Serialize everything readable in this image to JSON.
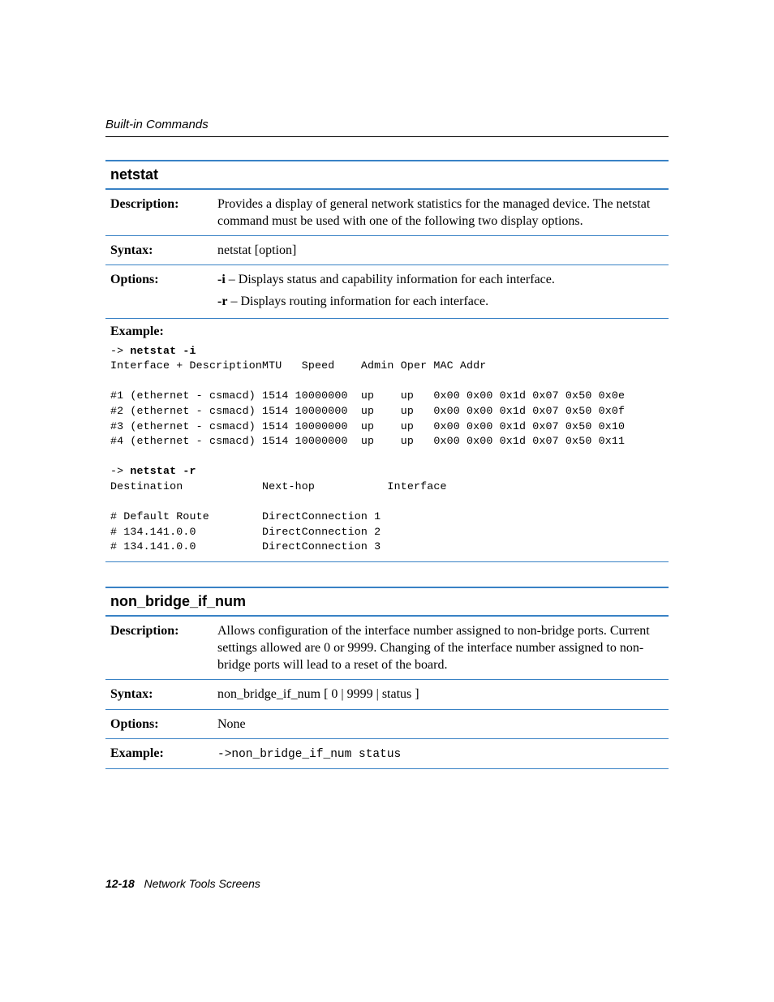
{
  "header": "Built-in Commands",
  "cmd1": {
    "title": "netstat",
    "desc_label": "Description:",
    "desc": "Provides a display of general network statistics for the managed device. The netstat command must be used with one of the following two display options.",
    "syntax_label": "Syntax:",
    "syntax": "netstat [option]",
    "options_label": "Options:",
    "opt_i_flag": "-i",
    "opt_i_text": " – Displays status and capability information for each interface.",
    "opt_r_flag": "-r",
    "opt_r_text": " – Displays routing information for each interface.",
    "example_label": "Example:",
    "example_prefix1": "-> ",
    "example_cmd1": "netstat -i",
    "example_body1": "Interface + DescriptionMTU   Speed    Admin Oper MAC Addr\n\n#1 (ethernet - csmacd) 1514 10000000  up    up   0x00 0x00 0x1d 0x07 0x50 0x0e\n#2 (ethernet - csmacd) 1514 10000000  up    up   0x00 0x00 0x1d 0x07 0x50 0x0f\n#3 (ethernet - csmacd) 1514 10000000  up    up   0x00 0x00 0x1d 0x07 0x50 0x10\n#4 (ethernet - csmacd) 1514 10000000  up    up   0x00 0x00 0x1d 0x07 0x50 0x11",
    "example_prefix2": "-> ",
    "example_cmd2": "netstat -r",
    "example_body2": "Destination            Next-hop           Interface\n\n# Default Route        DirectConnection 1\n# 134.141.0.0          DirectConnection 2\n# 134.141.0.0          DirectConnection 3"
  },
  "cmd2": {
    "title": "non_bridge_if_num",
    "desc_label": "Description:",
    "desc": "Allows configuration of the interface number assigned to non-bridge ports. Current settings allowed are 0 or 9999. Changing of the interface number assigned to non-bridge ports will lead to a reset of the board.",
    "syntax_label": "Syntax:",
    "syntax": "non_bridge_if_num  [ 0 | 9999 | status ]",
    "options_label": "Options:",
    "options": "None",
    "example_label": "Example:",
    "example": "->non_bridge_if_num status"
  },
  "footer": {
    "page": "12-18",
    "title": "Network Tools Screens"
  }
}
